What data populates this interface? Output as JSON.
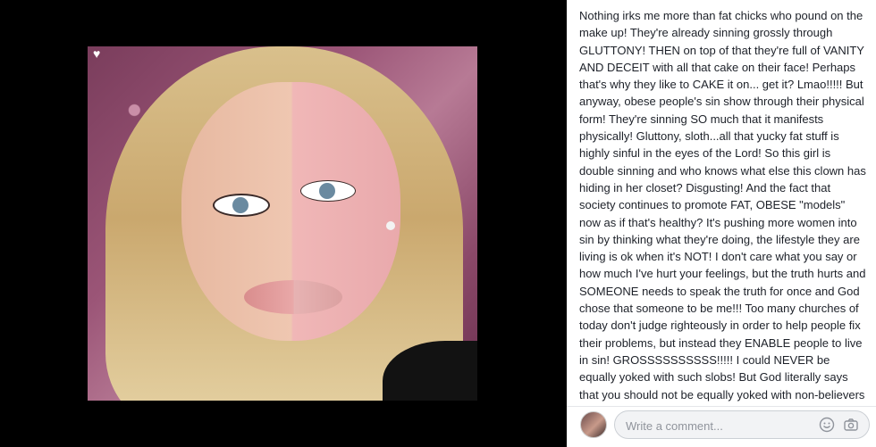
{
  "post": {
    "body": "Nothing irks me more than fat chicks who pound on the make up! They're already sinning grossly through GLUTTONY! THEN on top of that they're full of VANITY AND DECEIT with all that cake on their face! Perhaps that's why they like to CAKE it on... get it? Lmao!!!!! But anyway, obese people's sin show through their physical form! They're sinning SO much that it manifests physically! Gluttony, sloth...all that yucky fat stuff is highly sinful in the eyes of the Lord! So this girl is double sinning and who knows what else this clown has hiding in her closet? Disgusting! And the fact that society continues to promote FAT, OBESE \"models\" now as if that's healthy? It's pushing more women into sin by thinking what they're doing, the lifestyle they are living is ok when it's NOT! I don't care what you say or how much I've hurt your feelings, but the truth hurts and SOMEONE needs to speak the truth for once and God chose that someone to be me!!! Too many churches of today don't judge righteously in order to help people fix their problems, but instead they ENABLE people to live in sin! GROSSSSSSSSSS!!!!! I could NEVER be equally yoked with such slobs! But God literally says that you should not be equally yoked with non-believers or evil, wicked"
  },
  "comment": {
    "placeholder": "Write a comment..."
  },
  "icons": {
    "heart": "heart-icon",
    "emoji": "emoji-icon",
    "camera": "camera-icon"
  },
  "colors": {
    "background": "#000000",
    "panel": "#ffffff",
    "text": "#1d2129",
    "placeholder": "#90949c"
  }
}
